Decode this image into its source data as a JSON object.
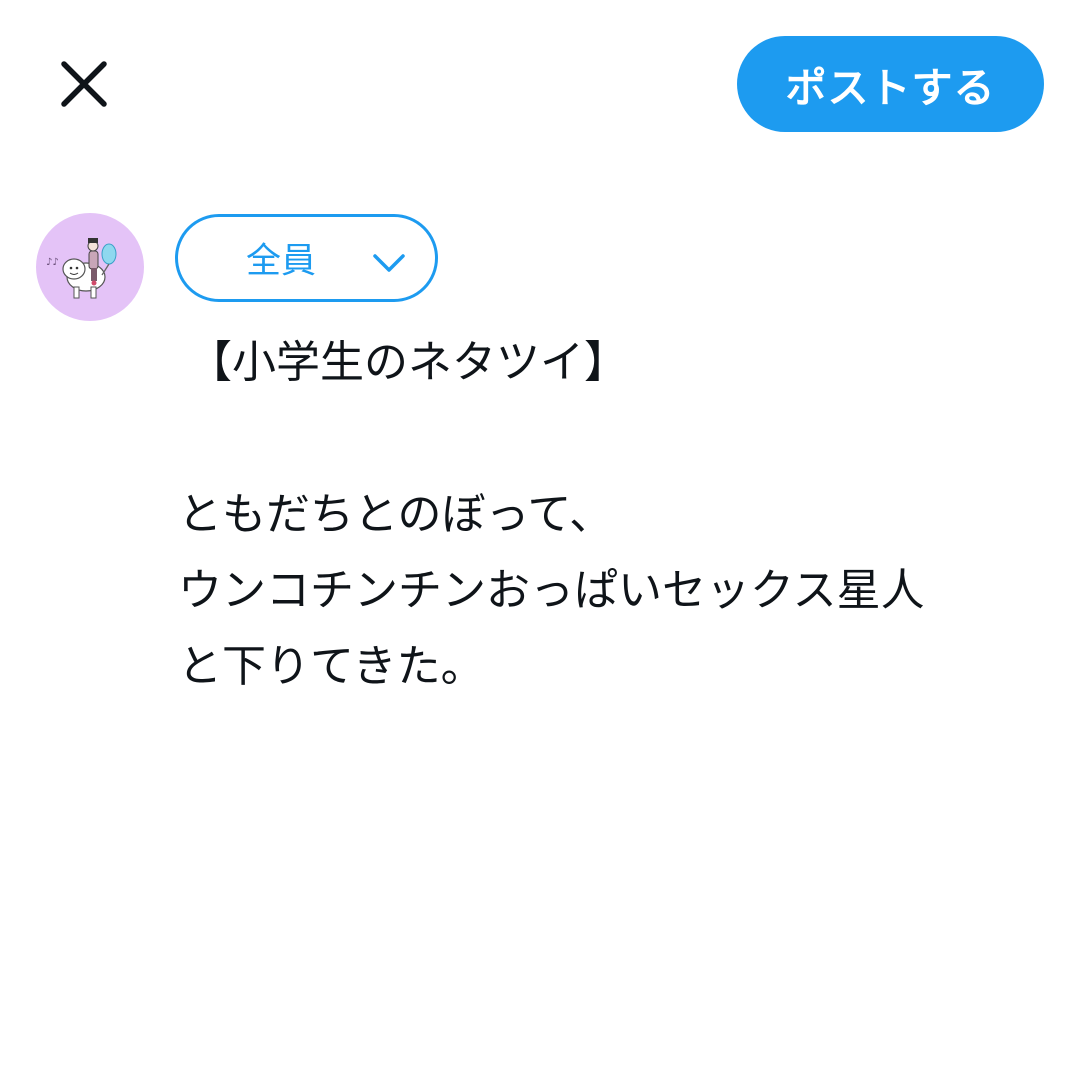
{
  "header": {
    "close_icon": "close-icon",
    "post_button_label": "ポストする",
    "accent_color": "#1d9bf0"
  },
  "compose": {
    "avatar_background": "#e4c3f7",
    "audience": {
      "label": "全員",
      "icon": "chevron-down-icon"
    },
    "text_lines": [
      "【小学生のネタツイ】",
      "",
      "ともだちとのぼって、",
      "ウンコチンチンおっぱいセックス星人",
      "と下りてきた。"
    ]
  }
}
